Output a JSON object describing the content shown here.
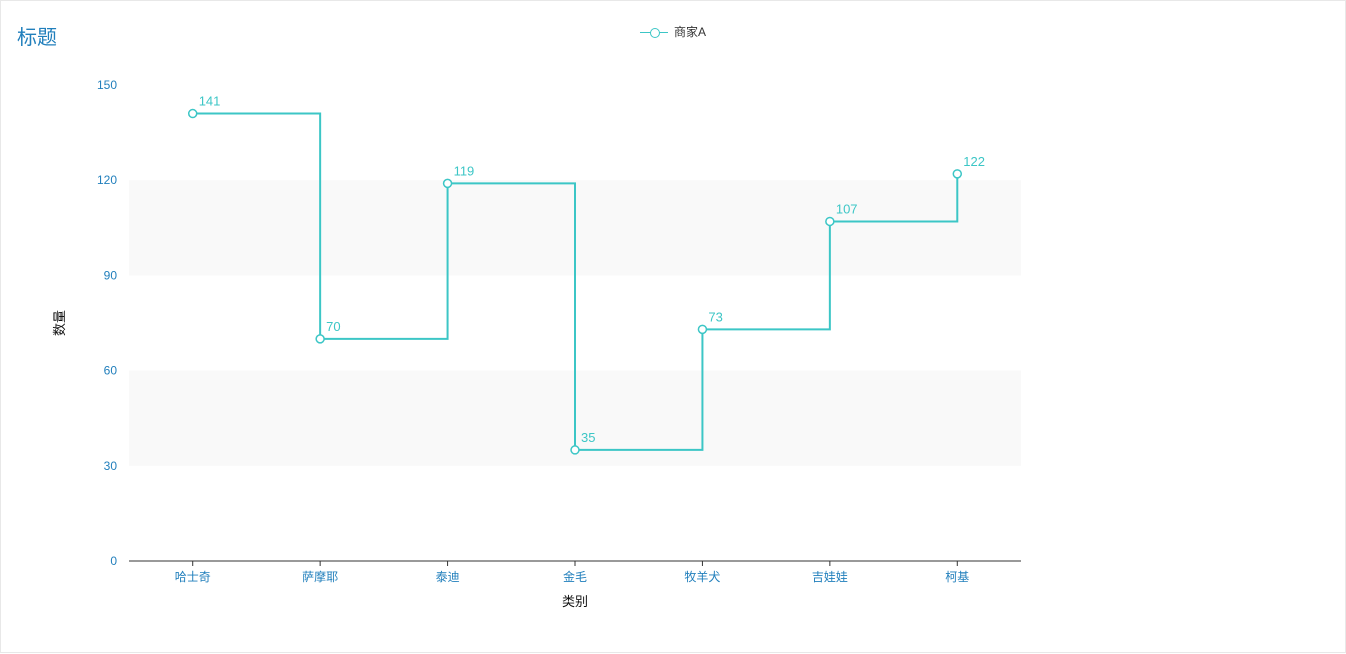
{
  "title": "标题",
  "legend": {
    "series_name": "商家A"
  },
  "axes": {
    "x_label": "类别",
    "y_label": "数量"
  },
  "chart_data": {
    "type": "line",
    "step": "hv",
    "categories": [
      "哈士奇",
      "萨摩耶",
      "泰迪",
      "金毛",
      "牧羊犬",
      "吉娃娃",
      "柯基"
    ],
    "series": [
      {
        "name": "商家A",
        "values": [
          141,
          70,
          119,
          35,
          73,
          107,
          122
        ]
      }
    ],
    "xlabel": "类别",
    "ylabel": "数量",
    "ylim": [
      0,
      150
    ],
    "y_ticks": [
      0,
      30,
      60,
      90,
      120,
      150
    ]
  }
}
